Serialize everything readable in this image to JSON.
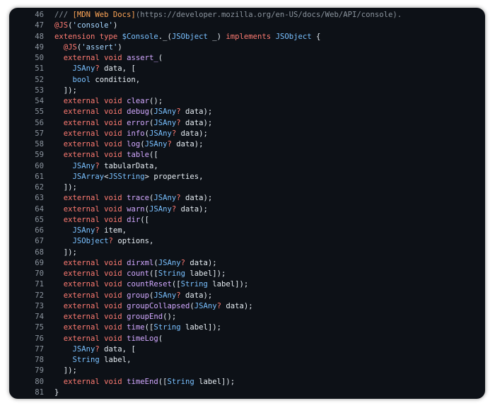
{
  "editor": {
    "colors": {
      "background": "#0d1117",
      "line_number": "#8b949e",
      "plain": "#e6edf3",
      "keyword": "#ff7b72",
      "type": "#79c0ff",
      "function": "#d2a8ff",
      "string": "#a5d6ff",
      "comment": "#8b949e",
      "link": "#ffa657"
    },
    "lines": [
      {
        "n": "46",
        "tokens": [
          [
            "cm",
            "/// "
          ],
          [
            "lk",
            "[MDN Web Docs]"
          ],
          [
            "cm",
            "(https://developer.mozilla.org/en-US/docs/Web/API/console)."
          ]
        ]
      },
      {
        "n": "47",
        "tokens": [
          [
            "kw",
            "@JS"
          ],
          [
            "pl",
            "("
          ],
          [
            "str",
            "'console'"
          ],
          [
            "pl",
            ")"
          ]
        ]
      },
      {
        "n": "48",
        "tokens": [
          [
            "kw",
            "extension type "
          ],
          [
            "ty",
            "$Console"
          ],
          [
            "pl",
            "._("
          ],
          [
            "ty",
            "JSObject"
          ],
          [
            "pl",
            " _) "
          ],
          [
            "kw",
            "implements "
          ],
          [
            "ty",
            "JSObject"
          ],
          [
            "pl",
            " {"
          ]
        ]
      },
      {
        "n": "49",
        "tokens": [
          [
            "pl",
            "  "
          ],
          [
            "kw",
            "@JS"
          ],
          [
            "pl",
            "("
          ],
          [
            "str",
            "'assert'"
          ],
          [
            "pl",
            ")"
          ]
        ]
      },
      {
        "n": "50",
        "tokens": [
          [
            "pl",
            "  "
          ],
          [
            "kw",
            "external void "
          ],
          [
            "fn",
            "assert_"
          ],
          [
            "pl",
            "("
          ]
        ]
      },
      {
        "n": "51",
        "tokens": [
          [
            "pl",
            "    "
          ],
          [
            "ty",
            "JSAny"
          ],
          [
            "kw",
            "?"
          ],
          [
            "pl",
            " data, ["
          ]
        ]
      },
      {
        "n": "52",
        "tokens": [
          [
            "pl",
            "    "
          ],
          [
            "ty",
            "bool"
          ],
          [
            "pl",
            " condition,"
          ]
        ]
      },
      {
        "n": "53",
        "tokens": [
          [
            "pl",
            "  ]);"
          ]
        ]
      },
      {
        "n": "54",
        "tokens": [
          [
            "pl",
            "  "
          ],
          [
            "kw",
            "external void "
          ],
          [
            "fn",
            "clear"
          ],
          [
            "pl",
            "();"
          ]
        ]
      },
      {
        "n": "55",
        "tokens": [
          [
            "pl",
            "  "
          ],
          [
            "kw",
            "external void "
          ],
          [
            "fn",
            "debug"
          ],
          [
            "pl",
            "("
          ],
          [
            "ty",
            "JSAny"
          ],
          [
            "kw",
            "?"
          ],
          [
            "pl",
            " data);"
          ]
        ]
      },
      {
        "n": "56",
        "tokens": [
          [
            "pl",
            "  "
          ],
          [
            "kw",
            "external void "
          ],
          [
            "fn",
            "error"
          ],
          [
            "pl",
            "("
          ],
          [
            "ty",
            "JSAny"
          ],
          [
            "kw",
            "?"
          ],
          [
            "pl",
            " data);"
          ]
        ]
      },
      {
        "n": "57",
        "tokens": [
          [
            "pl",
            "  "
          ],
          [
            "kw",
            "external void "
          ],
          [
            "fn",
            "info"
          ],
          [
            "pl",
            "("
          ],
          [
            "ty",
            "JSAny"
          ],
          [
            "kw",
            "?"
          ],
          [
            "pl",
            " data);"
          ]
        ]
      },
      {
        "n": "58",
        "tokens": [
          [
            "pl",
            "  "
          ],
          [
            "kw",
            "external void "
          ],
          [
            "fn",
            "log"
          ],
          [
            "pl",
            "("
          ],
          [
            "ty",
            "JSAny"
          ],
          [
            "kw",
            "?"
          ],
          [
            "pl",
            " data);"
          ]
        ]
      },
      {
        "n": "59",
        "tokens": [
          [
            "pl",
            "  "
          ],
          [
            "kw",
            "external void "
          ],
          [
            "fn",
            "table"
          ],
          [
            "pl",
            "(["
          ]
        ]
      },
      {
        "n": "60",
        "tokens": [
          [
            "pl",
            "    "
          ],
          [
            "ty",
            "JSAny"
          ],
          [
            "kw",
            "?"
          ],
          [
            "pl",
            " tabularData,"
          ]
        ]
      },
      {
        "n": "61",
        "tokens": [
          [
            "pl",
            "    "
          ],
          [
            "ty",
            "JSArray"
          ],
          [
            "pl",
            "<"
          ],
          [
            "ty",
            "JSString"
          ],
          [
            "pl",
            "> properties,"
          ]
        ]
      },
      {
        "n": "62",
        "tokens": [
          [
            "pl",
            "  ]);"
          ]
        ]
      },
      {
        "n": "63",
        "tokens": [
          [
            "pl",
            "  "
          ],
          [
            "kw",
            "external void "
          ],
          [
            "fn",
            "trace"
          ],
          [
            "pl",
            "("
          ],
          [
            "ty",
            "JSAny"
          ],
          [
            "kw",
            "?"
          ],
          [
            "pl",
            " data);"
          ]
        ]
      },
      {
        "n": "64",
        "tokens": [
          [
            "pl",
            "  "
          ],
          [
            "kw",
            "external void "
          ],
          [
            "fn",
            "warn"
          ],
          [
            "pl",
            "("
          ],
          [
            "ty",
            "JSAny"
          ],
          [
            "kw",
            "?"
          ],
          [
            "pl",
            " data);"
          ]
        ]
      },
      {
        "n": "65",
        "tokens": [
          [
            "pl",
            "  "
          ],
          [
            "kw",
            "external void "
          ],
          [
            "fn",
            "dir"
          ],
          [
            "pl",
            "(["
          ]
        ]
      },
      {
        "n": "66",
        "tokens": [
          [
            "pl",
            "    "
          ],
          [
            "ty",
            "JSAny"
          ],
          [
            "kw",
            "?"
          ],
          [
            "pl",
            " item,"
          ]
        ]
      },
      {
        "n": "67",
        "tokens": [
          [
            "pl",
            "    "
          ],
          [
            "ty",
            "JSObject"
          ],
          [
            "kw",
            "?"
          ],
          [
            "pl",
            " options,"
          ]
        ]
      },
      {
        "n": "68",
        "tokens": [
          [
            "pl",
            "  ]);"
          ]
        ]
      },
      {
        "n": "69",
        "tokens": [
          [
            "pl",
            "  "
          ],
          [
            "kw",
            "external void "
          ],
          [
            "fn",
            "dirxml"
          ],
          [
            "pl",
            "("
          ],
          [
            "ty",
            "JSAny"
          ],
          [
            "kw",
            "?"
          ],
          [
            "pl",
            " data);"
          ]
        ]
      },
      {
        "n": "70",
        "tokens": [
          [
            "pl",
            "  "
          ],
          [
            "kw",
            "external void "
          ],
          [
            "fn",
            "count"
          ],
          [
            "pl",
            "(["
          ],
          [
            "ty",
            "String"
          ],
          [
            "pl",
            " label]);"
          ]
        ]
      },
      {
        "n": "71",
        "tokens": [
          [
            "pl",
            "  "
          ],
          [
            "kw",
            "external void "
          ],
          [
            "fn",
            "countReset"
          ],
          [
            "pl",
            "(["
          ],
          [
            "ty",
            "String"
          ],
          [
            "pl",
            " label]);"
          ]
        ]
      },
      {
        "n": "72",
        "tokens": [
          [
            "pl",
            "  "
          ],
          [
            "kw",
            "external void "
          ],
          [
            "fn",
            "group"
          ],
          [
            "pl",
            "("
          ],
          [
            "ty",
            "JSAny"
          ],
          [
            "kw",
            "?"
          ],
          [
            "pl",
            " data);"
          ]
        ]
      },
      {
        "n": "73",
        "tokens": [
          [
            "pl",
            "  "
          ],
          [
            "kw",
            "external void "
          ],
          [
            "fn",
            "groupCollapsed"
          ],
          [
            "pl",
            "("
          ],
          [
            "ty",
            "JSAny"
          ],
          [
            "kw",
            "?"
          ],
          [
            "pl",
            " data);"
          ]
        ]
      },
      {
        "n": "74",
        "tokens": [
          [
            "pl",
            "  "
          ],
          [
            "kw",
            "external void "
          ],
          [
            "fn",
            "groupEnd"
          ],
          [
            "pl",
            "();"
          ]
        ]
      },
      {
        "n": "75",
        "tokens": [
          [
            "pl",
            "  "
          ],
          [
            "kw",
            "external void "
          ],
          [
            "fn",
            "time"
          ],
          [
            "pl",
            "(["
          ],
          [
            "ty",
            "String"
          ],
          [
            "pl",
            " label]);"
          ]
        ]
      },
      {
        "n": "76",
        "tokens": [
          [
            "pl",
            "  "
          ],
          [
            "kw",
            "external void "
          ],
          [
            "fn",
            "timeLog"
          ],
          [
            "pl",
            "("
          ]
        ]
      },
      {
        "n": "77",
        "tokens": [
          [
            "pl",
            "    "
          ],
          [
            "ty",
            "JSAny"
          ],
          [
            "kw",
            "?"
          ],
          [
            "pl",
            " data, ["
          ]
        ]
      },
      {
        "n": "78",
        "tokens": [
          [
            "pl",
            "    "
          ],
          [
            "ty",
            "String"
          ],
          [
            "pl",
            " label,"
          ]
        ]
      },
      {
        "n": "79",
        "tokens": [
          [
            "pl",
            "  ]);"
          ]
        ]
      },
      {
        "n": "80",
        "tokens": [
          [
            "pl",
            "  "
          ],
          [
            "kw",
            "external void "
          ],
          [
            "fn",
            "timeEnd"
          ],
          [
            "pl",
            "(["
          ],
          [
            "ty",
            "String"
          ],
          [
            "pl",
            " label]);"
          ]
        ]
      },
      {
        "n": "81",
        "tokens": [
          [
            "pl",
            "}"
          ]
        ]
      }
    ]
  }
}
